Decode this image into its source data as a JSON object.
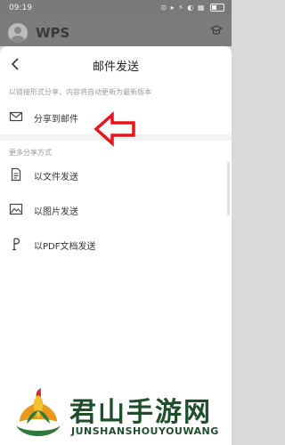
{
  "status_bar": {
    "time": "09:19",
    "icons": "⊙ ▸ ⚡ ◐ ▦"
  },
  "app_header": {
    "logo_text": "WPS"
  },
  "sheet": {
    "title": "邮件发送",
    "hint": "以链接形式分享，内容将自动更新为最新版本",
    "share_mail_label": "分享到邮件",
    "section_label": "更多分享方式",
    "options": [
      {
        "label": "以文件发送",
        "icon": "file-icon"
      },
      {
        "label": "以图片发送",
        "icon": "image-icon"
      },
      {
        "label": "以PDF文档发送",
        "icon": "pdf-icon"
      }
    ]
  },
  "colors": {
    "arrow": "#e8141b",
    "watermark_green": "#1f4e2b"
  },
  "watermark": {
    "title": "君山手游网",
    "subtitle": "JUNSHANSHOUYOUWANG"
  }
}
